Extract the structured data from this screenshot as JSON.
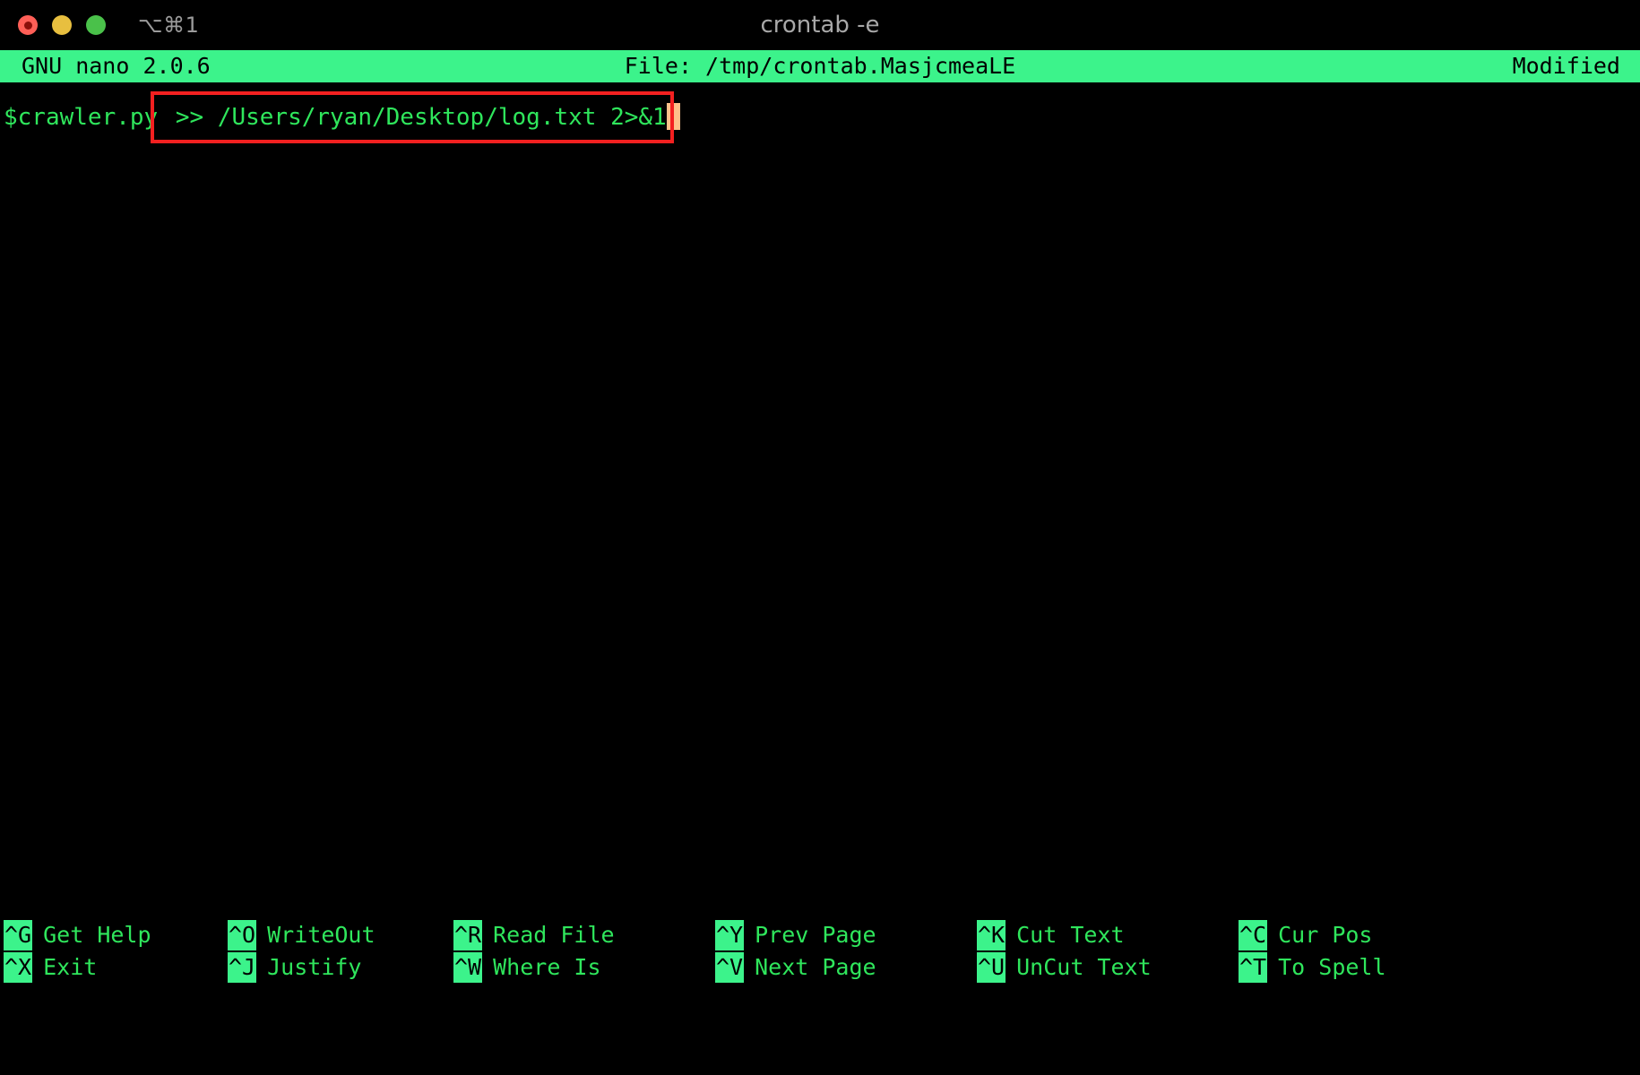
{
  "window": {
    "title": "crontab -e",
    "shortcut_hint": "⌥⌘1",
    "traffic_lights": [
      {
        "name": "close",
        "color": "#ff5f57"
      },
      {
        "name": "minimize",
        "color": "#e8bf3f"
      },
      {
        "name": "maximize",
        "color": "#4ac14a"
      }
    ]
  },
  "nano_header": {
    "version": "GNU nano 2.0.6",
    "file": "File: /tmp/crontab.MasjcmeaLE",
    "status": "Modified",
    "background": "#3cf38b",
    "foreground": "#000000"
  },
  "editor": {
    "line_prefix": "$crawler.py",
    "line_highlighted": " >> /Users/ryan/Desktop/log.txt 2>&1",
    "full_line": "$crawler.py >> /Users/ryan/Desktop/log.txt 2>&1",
    "text_color": "#2fe65c",
    "highlight_box_color": "#f32020",
    "cursor_color": "#ffc08a"
  },
  "help_bar": {
    "rows": [
      [
        {
          "key": "^G",
          "label": "Get Help"
        },
        {
          "key": "^O",
          "label": "WriteOut"
        },
        {
          "key": "^R",
          "label": "Read File"
        },
        {
          "key": "^Y",
          "label": "Prev Page"
        },
        {
          "key": "^K",
          "label": "Cut Text"
        },
        {
          "key": "^C",
          "label": "Cur Pos"
        }
      ],
      [
        {
          "key": "^X",
          "label": "Exit"
        },
        {
          "key": "^J",
          "label": "Justify"
        },
        {
          "key": "^W",
          "label": "Where Is"
        },
        {
          "key": "^V",
          "label": "Next Page"
        },
        {
          "key": "^U",
          "label": "UnCut Text"
        },
        {
          "key": "^T",
          "label": "To Spell"
        }
      ]
    ]
  }
}
